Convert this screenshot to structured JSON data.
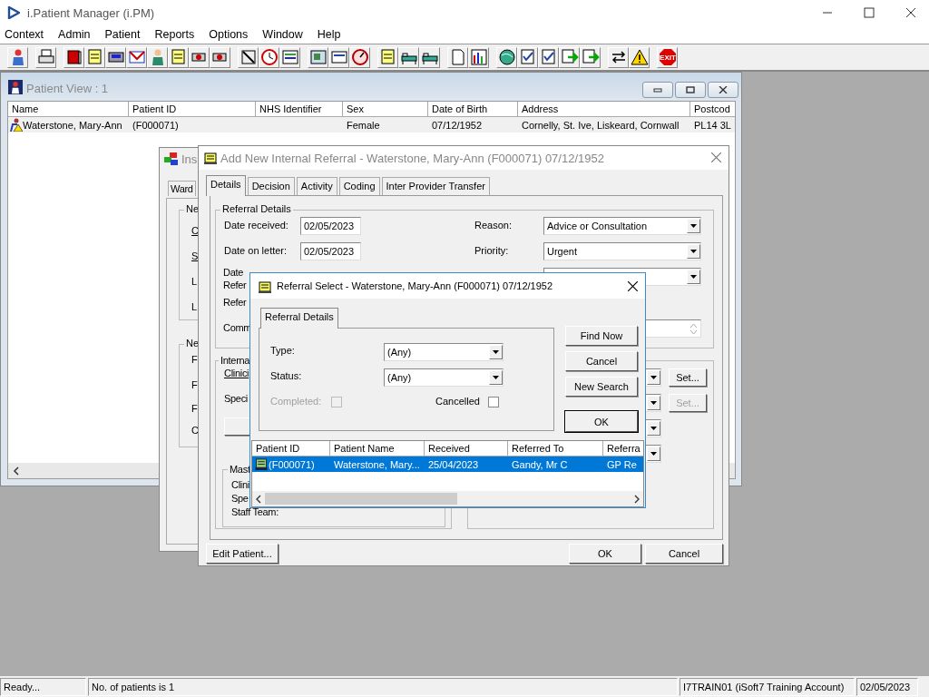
{
  "app": {
    "title": "i.Patient Manager (i.PM)"
  },
  "menu": [
    "Context",
    "Admin",
    "Patient",
    "Reports",
    "Options",
    "Window",
    "Help"
  ],
  "toolbar": [
    [
      {
        "kind": "person"
      }
    ],
    [
      {
        "kind": "printer"
      }
    ],
    [
      {
        "kind": "book"
      },
      {
        "kind": "note"
      },
      {
        "kind": "scanner"
      },
      {
        "kind": "mail"
      },
      {
        "kind": "doctor"
      },
      {
        "kind": "note"
      },
      {
        "kind": "camera"
      },
      {
        "kind": "camera"
      }
    ],
    [
      {
        "kind": "tools"
      },
      {
        "kind": "clock"
      },
      {
        "kind": "list"
      }
    ],
    [
      {
        "kind": "picture"
      },
      {
        "kind": "card"
      },
      {
        "kind": "gauge"
      }
    ],
    [
      {
        "kind": "note"
      },
      {
        "kind": "bed"
      },
      {
        "kind": "bed"
      }
    ],
    [
      {
        "kind": "document"
      },
      {
        "kind": "chart"
      }
    ],
    [
      {
        "kind": "globe"
      },
      {
        "kind": "check"
      },
      {
        "kind": "check"
      },
      {
        "kind": "transfer"
      },
      {
        "kind": "transfer"
      }
    ],
    [
      {
        "kind": "arrows"
      },
      {
        "kind": "warning"
      }
    ],
    [
      {
        "kind": "exit",
        "label": "EXIT"
      }
    ]
  ],
  "patient_view": {
    "title": "Patient View : 1",
    "columns": [
      "Name",
      "Patient ID",
      "NHS Identifier",
      "Sex",
      "Date of Birth",
      "Address",
      "Postcod"
    ],
    "rows": [
      {
        "selected": true,
        "cells": [
          "Waterstone, Mary-Ann",
          "(F000071)",
          "",
          "Female",
          "07/12/1952",
          "Cornelly, St. Ive, Liskeard, Cornwall",
          "PL14 3L"
        ]
      }
    ]
  },
  "insert_window": {
    "title": "Ins",
    "tab": "Ward",
    "groups": [
      {
        "legend": "Ne",
        "labels": [
          "C",
          "S",
          "L",
          "L"
        ]
      },
      {
        "legend": "Ne",
        "labels": [
          "F",
          "F",
          "F",
          "C"
        ]
      }
    ]
  },
  "referral_dialog": {
    "title": "Add New Internal Referral - Waterstone, Mary-Ann (F000071) 07/12/1952",
    "tabs": [
      {
        "label": "Details",
        "selected": true
      },
      {
        "label": "Decision",
        "selected": false
      },
      {
        "label": "Activity",
        "selected": false
      },
      {
        "label": "Coding",
        "selected": false
      },
      {
        "label": "Inter Provider Transfer",
        "selected": false
      }
    ],
    "group": "Referral Details",
    "left_fields": [
      {
        "label": "Date received:",
        "value": "02/05/2023"
      },
      {
        "label": "Date on letter:",
        "value": "02/05/2023"
      }
    ],
    "partial_labels": [
      "Date",
      "Refer",
      "Refer",
      "Comm"
    ],
    "right_fields": [
      {
        "kind": "dropdown",
        "label": "Reason:",
        "value": "Advice or Consultation"
      },
      {
        "kind": "dropdown",
        "label": "Priority:",
        "value": "Urgent"
      },
      {
        "kind": "dropdown"
      },
      {
        "kind": "memo"
      }
    ],
    "internal_group": {
      "legend": "Interna",
      "labels": [
        "Clinici",
        "Speci"
      ],
      "master_legend": "Mast",
      "master_labels": [
        "Clini",
        "Spe",
        "Staff Team:"
      ]
    },
    "right_group": [
      {
        "kind": "dropdown",
        "set": {
          "label": "Set...",
          "disabled": false
        }
      },
      {
        "kind": "dropdown",
        "set": {
          "label": "Set...",
          "disabled": true
        }
      },
      {
        "kind": "dropdown"
      },
      {
        "kind": "dropdown"
      }
    ],
    "buttons": [
      "Edit Patient...",
      "OK",
      "Cancel"
    ]
  },
  "select_dialog": {
    "title": "Referral Select - Waterstone, Mary-Ann (F000071) 07/12/1952",
    "tab": {
      "label": "Referral Details",
      "selected": true
    },
    "fields": [
      {
        "label": "Type:",
        "value": "(Any)"
      },
      {
        "label": "Status:",
        "value": "(Any)"
      }
    ],
    "checkboxes": [
      {
        "label": "Completed:",
        "checked": false,
        "disabled": true
      },
      {
        "label": "Cancelled",
        "checked": false,
        "disabled": false
      }
    ],
    "buttons": [
      "Find Now",
      "Cancel",
      "New Search",
      "OK"
    ],
    "columns": [
      "Patient ID",
      "Patient Name",
      "Received",
      "Referred To",
      "Referra"
    ],
    "rows": [
      {
        "selected": true,
        "cells": [
          "(F000071)",
          "Waterstone, Mary...",
          "25/04/2023",
          "Gandy, Mr C",
          "GP Re"
        ]
      }
    ]
  },
  "status_bar": [
    "Ready...",
    "No. of patients is 1",
    "I7TRAIN01 (iSoft7 Training Account)",
    "02/05/2023"
  ]
}
